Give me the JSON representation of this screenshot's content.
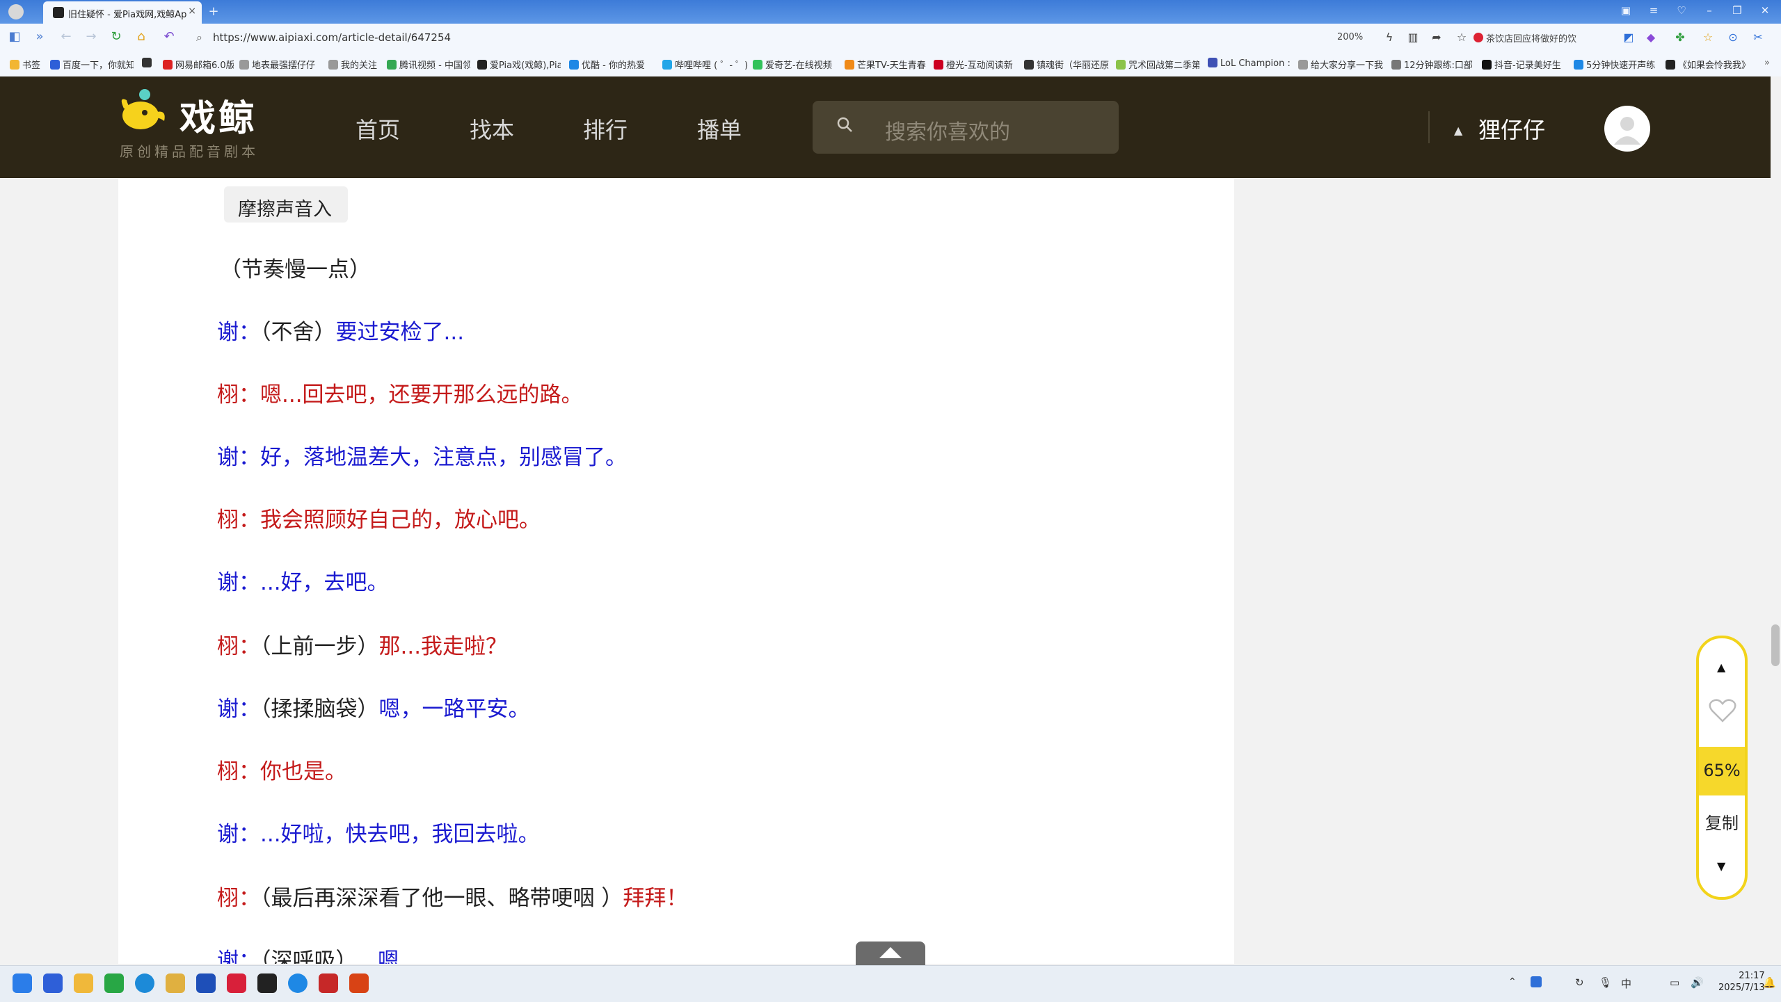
{
  "browser": {
    "tab_title": "旧住疑怀 - 爱Pia戏网,戏鲸App",
    "close_glyph": "×",
    "new_tab_glyph": "+",
    "url": "https://www.aipiaxi.com/article-detail/647254",
    "zoom": "200%",
    "news": "茶饮店回应将做好的饮",
    "bookmarks": [
      "书签",
      "百度一下，你就知",
      "",
      "网易邮箱6.0版",
      "地表最强摆仔仔",
      "我的关注",
      "腾讯视频 - 中国领",
      "爱Pia戏(戏鲸),Pia",
      "优酷 - 你的热爱",
      "哔哩哔哩 ( ゜- ゜)",
      "爱奇艺-在线视频",
      "芒果TV-天生青春",
      "橙光-互动阅读新",
      "镇魂街（华丽还原",
      "咒术回战第二季第",
      "LoL Champion :",
      "给大家分享一下我",
      "12分钟跟练:口部",
      "抖音-记录美好生",
      "5分钟快速开声练",
      "《如果会怜我我》"
    ]
  },
  "site": {
    "logo_text": "戏鲸",
    "logo_sub": "原创精品配音剧本",
    "nav": [
      "首页",
      "找本",
      "排行",
      "播单"
    ],
    "search_placeholder": "搜索你喜欢的",
    "username": "狸仔仔"
  },
  "script": {
    "sfx_tag": "摩擦声音入",
    "direction": "（节奏慢一点）",
    "lines": [
      {
        "speaker": "谢：",
        "stage": "（不舍）",
        "text": "要过安检了...",
        "role": "xie"
      },
      {
        "speaker": "栩：",
        "stage": "",
        "text": "嗯...回去吧，还要开那么远的路。",
        "role": "xu"
      },
      {
        "speaker": "谢：",
        "stage": "",
        "text": "好，落地温差大，注意点，别感冒了。",
        "role": "xie"
      },
      {
        "speaker": "栩：",
        "stage": "",
        "text": "我会照顾好自己的，放心吧。",
        "role": "xu"
      },
      {
        "speaker": "谢：",
        "stage": "",
        "text": "...好，去吧。",
        "role": "xie"
      },
      {
        "speaker": "栩：",
        "stage": "（上前一步）",
        "text": "那...我走啦？",
        "role": "xu"
      },
      {
        "speaker": "谢：",
        "stage": "（揉揉脑袋）",
        "text": "嗯，一路平安。",
        "role": "xie"
      },
      {
        "speaker": "栩：",
        "stage": "",
        "text": "你也是。",
        "role": "xu"
      },
      {
        "speaker": "谢：",
        "stage": "",
        "text": "...好啦，快去吧，我回去啦。",
        "role": "xie"
      },
      {
        "speaker": "栩：",
        "stage": "（最后再深深看了他一眼、略带哽咽 ）",
        "text": "拜拜！",
        "role": "xu"
      },
      {
        "speaker": "谢：",
        "stage": "（深呼吸）",
        "text": "...嗯",
        "role": "xie"
      }
    ]
  },
  "widget": {
    "progress": "65%",
    "copy": "复制"
  },
  "taskbar": {
    "time": "21:17",
    "date": "2025/7/13"
  },
  "colors": {
    "header_bg": "#2d2616",
    "xie": "#1a1ad0",
    "xu": "#c41a1a",
    "accent_yellow": "#f2d31a"
  }
}
